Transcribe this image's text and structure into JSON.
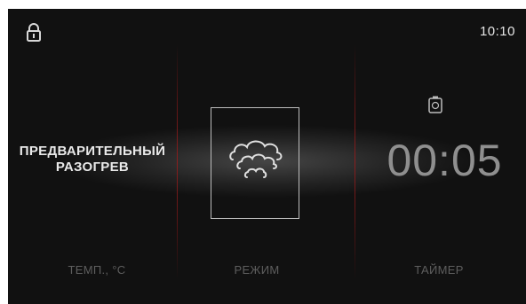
{
  "status": {
    "lock_icon": "lock-icon",
    "time": "10:10"
  },
  "temperature": {
    "mode_line1": "ПРЕДВАРИТЕЛЬНЫЙ",
    "mode_line2": "РАЗОГРЕВ",
    "label": "ТЕМП., °C"
  },
  "mode": {
    "icon": "steam-cloud-icon",
    "label": "РЕЖИМ"
  },
  "timer": {
    "icon": "timer-icon",
    "value": "00:05",
    "label": "ТАЙМЕР"
  },
  "colors": {
    "background": "#111111",
    "divider": "#8c1f1f",
    "text_primary": "#e9e9e9",
    "text_dim": "#5e5e5e",
    "timer_digits": "#8f8f8f"
  }
}
